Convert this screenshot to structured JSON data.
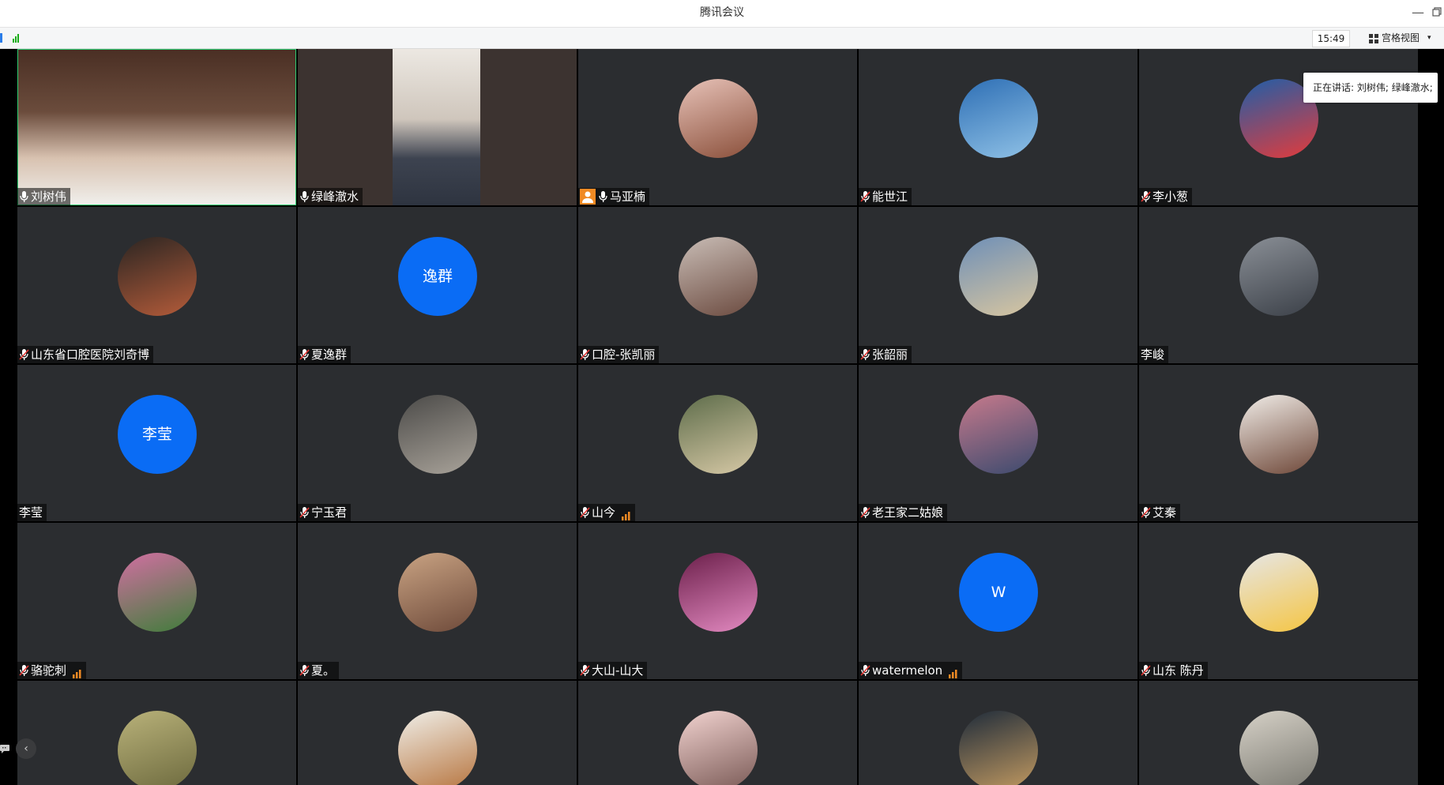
{
  "window": {
    "title": "腾讯会议",
    "minimize_icon": "minimize-icon",
    "restore_icon": "restore-icon"
  },
  "toolbar": {
    "time": "15:49",
    "view_label": "宫格视图",
    "view_caret": "▾"
  },
  "speaking": {
    "text": "正在讲话: 刘树伟; 绿峰澈水;"
  },
  "colors": {
    "tile_bg": "#2b2d30",
    "avatar_blue": "#0a6cf5",
    "host_orange": "#f08a24",
    "active_border": "#2ecc71"
  },
  "participants": [
    {
      "name": "刘树伟",
      "mic": "on",
      "avatar": "video"
    },
    {
      "name": "绿峰澈水",
      "mic": "on",
      "avatar": "video"
    },
    {
      "name": "马亚楠",
      "mic": "on",
      "host": true,
      "avatar": "photo"
    },
    {
      "name": "能世江",
      "mic": "muted",
      "avatar": "photo"
    },
    {
      "name": "李小葱",
      "mic": "muted",
      "avatar": "photo"
    },
    {
      "name": "山东省口腔医院刘奇博",
      "mic": "muted",
      "avatar": "photo"
    },
    {
      "name": "夏逸群",
      "mic": "muted",
      "avatar_text": "逸群"
    },
    {
      "name": "口腔-张凯丽",
      "mic": "muted",
      "avatar": "photo"
    },
    {
      "name": "张韶丽",
      "mic": "muted",
      "avatar": "photo"
    },
    {
      "name": "李峻",
      "mic": "none",
      "avatar": "photo"
    },
    {
      "name": "李莹",
      "mic": "none",
      "avatar_text": "李莹"
    },
    {
      "name": "宁玉君",
      "mic": "muted",
      "avatar": "photo"
    },
    {
      "name": "山今",
      "mic": "muted",
      "signal": true,
      "avatar": "photo"
    },
    {
      "name": "老王家二姑娘",
      "mic": "muted",
      "avatar": "photo"
    },
    {
      "name": "艾秦",
      "mic": "muted",
      "avatar": "photo"
    },
    {
      "name": "骆驼刺",
      "mic": "muted",
      "signal": true,
      "avatar": "photo"
    },
    {
      "name": "夏。",
      "mic": "muted",
      "avatar": "photo"
    },
    {
      "name": "大山-山大",
      "mic": "muted",
      "avatar": "photo"
    },
    {
      "name": "watermelon",
      "mic": "muted",
      "signal": true,
      "avatar_text": "W"
    },
    {
      "name": "山东 陈丹",
      "mic": "muted",
      "avatar": "photo"
    },
    {
      "name": "",
      "avatar": "photo"
    },
    {
      "name": "",
      "avatar": "photo"
    },
    {
      "name": "",
      "avatar": "photo"
    },
    {
      "name": "",
      "avatar": "photo"
    },
    {
      "name": "",
      "avatar": "photo"
    }
  ]
}
